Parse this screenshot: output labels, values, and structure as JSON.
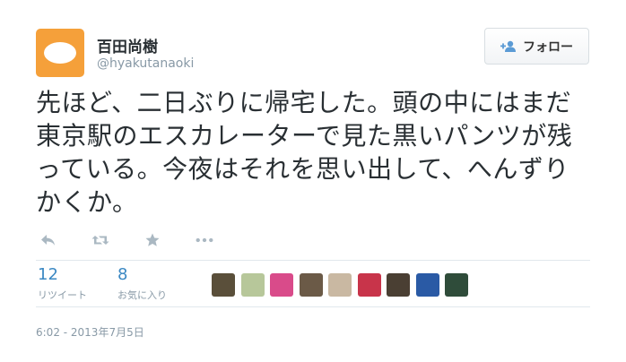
{
  "profile": {
    "name": "百田尚樹",
    "handle": "@hyakutanaoki",
    "avatar_color": "#f5a03a"
  },
  "follow_button": {
    "label": "フォロー",
    "icon": "add-user-icon"
  },
  "tweet": {
    "text": "先ほど、二日ぶりに帰宅した。頭の中にはまだ東京駅のエスカレーターで見た黒いパンツが残っている。今夜はそれを思い出して、へんずりかくか。"
  },
  "actions": [
    {
      "icon": "reply-icon"
    },
    {
      "icon": "retweet-icon"
    },
    {
      "icon": "favorite-star-icon"
    },
    {
      "icon": "more-icon"
    }
  ],
  "stats": {
    "retweets": {
      "count": "12",
      "label": "リツイート"
    },
    "favorites": {
      "count": "8",
      "label": "お気に入り"
    }
  },
  "favoriters": [
    {
      "color": "#5a4f3a"
    },
    {
      "color": "#b7c79a"
    },
    {
      "color": "#d94b8a"
    },
    {
      "color": "#6b5a47"
    },
    {
      "color": "#c9b8a2"
    },
    {
      "color": "#c8344a"
    },
    {
      "color": "#4a3f33"
    },
    {
      "color": "#2a5aa5"
    },
    {
      "color": "#2f4c3a"
    }
  ],
  "timestamp": "6:02 - 2013年7月5日",
  "colors": {
    "accent": "#3b88c3",
    "muted": "#8899a6",
    "text": "#292f33"
  }
}
